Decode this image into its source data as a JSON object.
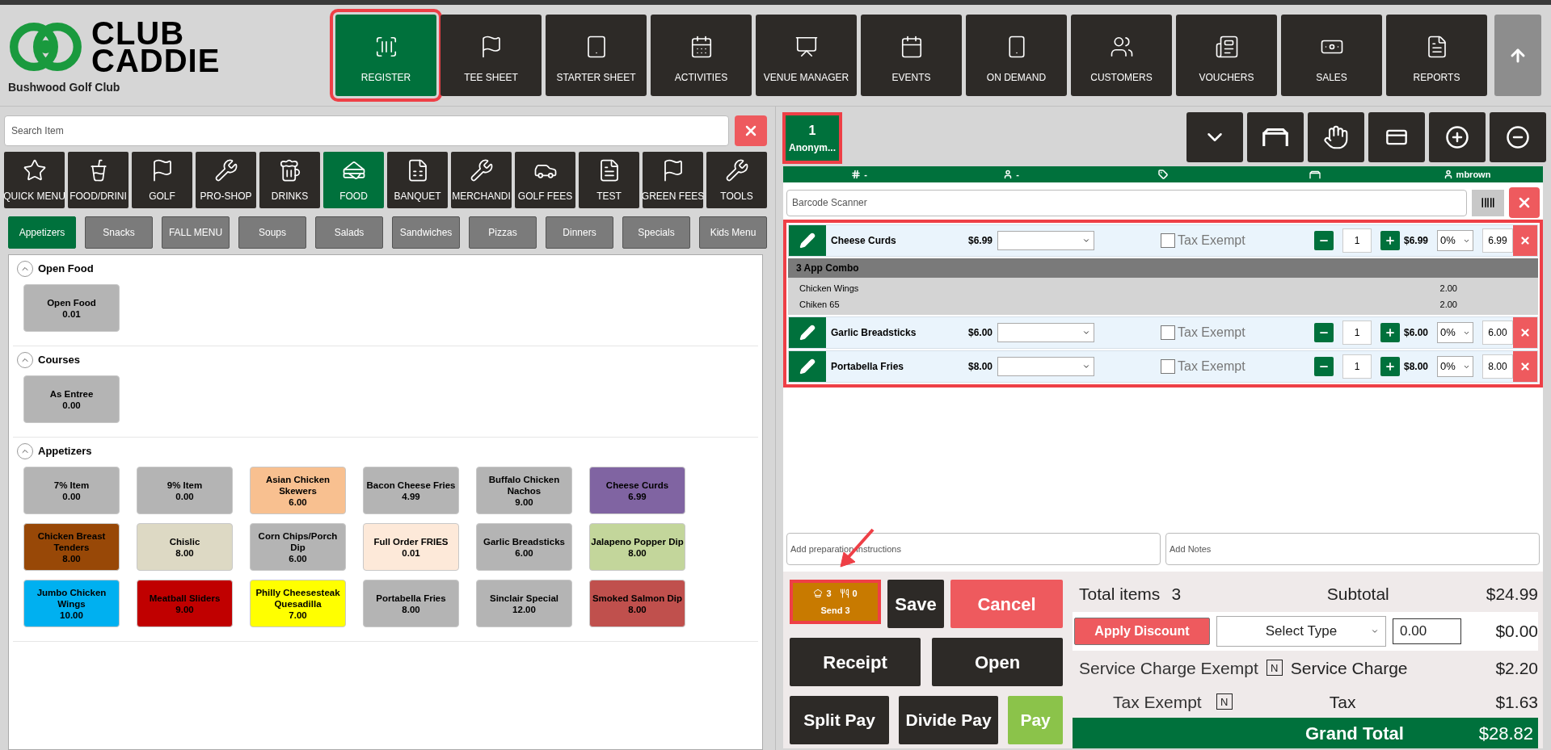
{
  "logo": {
    "line1": "CLUB",
    "line2": "CADDIE",
    "club": "Bushwood Golf Club"
  },
  "nav": [
    {
      "label": "REGISTER",
      "selected": true,
      "highlighted": true
    },
    {
      "label": "TEE SHEET",
      "selected": false,
      "highlighted": false
    },
    {
      "label": "STARTER SHEET",
      "selected": false,
      "highlighted": false
    },
    {
      "label": "ACTIVITIES",
      "selected": false,
      "highlighted": false
    },
    {
      "label": "VENUE MANAGER",
      "selected": false,
      "highlighted": false
    },
    {
      "label": "EVENTS",
      "selected": false,
      "highlighted": false
    },
    {
      "label": "ON DEMAND",
      "selected": false,
      "highlighted": false
    },
    {
      "label": "CUSTOMERS",
      "selected": false,
      "highlighted": false
    },
    {
      "label": "VOUCHERS",
      "selected": false,
      "highlighted": false
    },
    {
      "label": "SALES",
      "selected": false,
      "highlighted": false
    },
    {
      "label": "REPORTS",
      "selected": false,
      "highlighted": false
    }
  ],
  "search": {
    "placeholder": "Search Item"
  },
  "categories": [
    {
      "label": "QUICK MENU",
      "selected": false
    },
    {
      "label": "FOOD/DRINI",
      "selected": false
    },
    {
      "label": "GOLF",
      "selected": false
    },
    {
      "label": "PRO-SHOP",
      "selected": false
    },
    {
      "label": "DRINKS",
      "selected": false
    },
    {
      "label": "FOOD",
      "selected": true
    },
    {
      "label": "BANQUET",
      "selected": false
    },
    {
      "label": "MERCHANDI",
      "selected": false
    },
    {
      "label": "GOLF FEES",
      "selected": false
    },
    {
      "label": "TEST",
      "selected": false
    },
    {
      "label": "GREEN FEES",
      "selected": false
    },
    {
      "label": "TOOLS",
      "selected": false
    }
  ],
  "subcategories": [
    {
      "label": "Appetizers",
      "selected": true
    },
    {
      "label": "Snacks",
      "selected": false
    },
    {
      "label": "FALL MENU",
      "selected": false
    },
    {
      "label": "Soups",
      "selected": false
    },
    {
      "label": "Salads",
      "selected": false
    },
    {
      "label": "Sandwiches",
      "selected": false
    },
    {
      "label": "Pizzas",
      "selected": false
    },
    {
      "label": "Dinners",
      "selected": false
    },
    {
      "label": "Specials",
      "selected": false
    },
    {
      "label": "Kids Menu",
      "selected": false
    }
  ],
  "sections": [
    {
      "title": "Open Food",
      "expanded": true,
      "items": [
        {
          "name": "Open Food",
          "price": "0.01",
          "color": "#b4b4b4"
        }
      ]
    },
    {
      "title": "Courses",
      "expanded": true,
      "items": [
        {
          "name": "As Entree",
          "price": "0.00",
          "color": "#b4b4b4"
        }
      ]
    },
    {
      "title": "Appetizers",
      "expanded": true,
      "items": [
        {
          "name": "7% Item",
          "price": "0.00",
          "color": "#b4b4b4"
        },
        {
          "name": "9% Item",
          "price": "0.00",
          "color": "#b4b4b4"
        },
        {
          "name": "Asian Chicken Skewers",
          "price": "6.00",
          "color": "#f8c090"
        },
        {
          "name": "Bacon Cheese Fries",
          "price": "4.99",
          "color": "#b4b4b4"
        },
        {
          "name": "Buffalo Chicken Nachos",
          "price": "9.00",
          "color": "#b4b4b4"
        },
        {
          "name": "Cheese Curds",
          "price": "6.99",
          "color": "#8064a2"
        },
        {
          "name": "Chicken Breast Tenders",
          "price": "8.00",
          "color": "#984807"
        },
        {
          "name": "Chislic",
          "price": "8.00",
          "color": "#ddd9c4"
        },
        {
          "name": "Corn Chips/Porch Dip",
          "price": "6.00",
          "color": "#b4b4b4"
        },
        {
          "name": "Full Order FRIES",
          "price": "0.01",
          "color": "#fde9d9"
        },
        {
          "name": "Garlic Breadsticks",
          "price": "6.00",
          "color": "#b4b4b4"
        },
        {
          "name": "Jalapeno Popper Dip",
          "price": "8.00",
          "color": "#c3d69b"
        },
        {
          "name": "Jumbo Chicken Wings",
          "price": "10.00",
          "color": "#00b0f0"
        },
        {
          "name": "Meatball Sliders",
          "price": "9.00",
          "color": "#c00000"
        },
        {
          "name": "Philly Cheesesteak Quesadilla",
          "price": "7.00",
          "color": "#ffff00"
        },
        {
          "name": "Portabella Fries",
          "price": "8.00",
          "color": "#b4b4b4"
        },
        {
          "name": "Sinclair Special",
          "price": "12.00",
          "color": "#b4b4b4"
        },
        {
          "name": "Smoked Salmon Dip",
          "price": "8.00",
          "color": "#c0504d"
        }
      ]
    }
  ],
  "customer_tab": {
    "number": "1",
    "name": "Anonym...",
    "selected": true,
    "highlighted": true
  },
  "info_bar": {
    "check": "-",
    "customer": "-",
    "user": "mbrown"
  },
  "barcode": {
    "placeholder": "Barcode Scanner"
  },
  "order_highlighted": true,
  "order_lines": [
    {
      "kind": "item",
      "name": "Cheese Curds",
      "price": "$6.99",
      "tax_label": "Tax Exempt",
      "tax_exempt": false,
      "qty": "1",
      "line_price": "$6.99",
      "discount": "0%",
      "amount": "6.99"
    },
    {
      "kind": "combo",
      "name": "3 App Combo",
      "children": [
        {
          "name": "Chicken Wings",
          "amount": "2.00"
        },
        {
          "name": "Chiken 65",
          "amount": "2.00"
        }
      ]
    },
    {
      "kind": "item",
      "name": "Garlic Breadsticks",
      "price": "$6.00",
      "tax_label": "Tax Exempt",
      "tax_exempt": false,
      "qty": "1",
      "line_price": "$6.00",
      "discount": "0%",
      "amount": "6.00"
    },
    {
      "kind": "item",
      "name": "Portabella Fries",
      "price": "$8.00",
      "tax_label": "Tax Exempt",
      "tax_exempt": false,
      "qty": "1",
      "line_price": "$8.00",
      "discount": "0%",
      "amount": "8.00"
    }
  ],
  "prep_field": {
    "placeholder": "Add preparation instructions"
  },
  "notes_field": {
    "placeholder": "Add Notes"
  },
  "send": {
    "sent": "3",
    "pending": "0",
    "label": "Send 3",
    "highlighted": true
  },
  "callout_arrow": true,
  "buttons": {
    "save": "Save",
    "cancel": "Cancel",
    "receipt": "Receipt",
    "open": "Open",
    "split": "Split Pay",
    "divide": "Divide Pay",
    "pay": "Pay"
  },
  "totals": {
    "items_label": "Total items",
    "items": "3",
    "subtotal_label": "Subtotal",
    "subtotal": "$24.99",
    "discount_button": "Apply Discount",
    "discount_type": "Select Type",
    "discount_value": "0.00",
    "discount": "$0.00",
    "service_exempt_label": "Service Charge Exempt",
    "service_exempt": "N",
    "service_label": "Service Charge",
    "service": "$2.20",
    "tax_exempt_label": "Tax Exempt",
    "tax_exempt": "N",
    "tax_label": "Tax",
    "tax": "$1.63",
    "grand_label": "Grand Total",
    "grand": "$28.82"
  }
}
